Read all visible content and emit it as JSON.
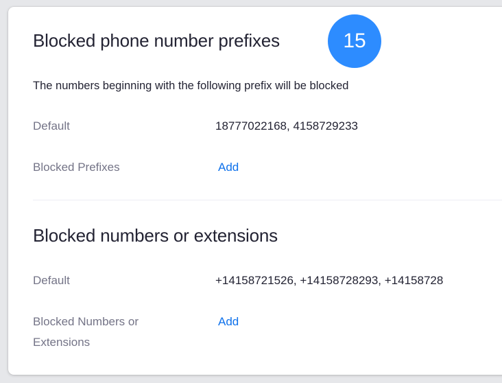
{
  "prefixes_section": {
    "title": "Blocked phone number prefixes",
    "badge": "15",
    "description": "The numbers beginning with the following prefix will be blocked",
    "default_label": "Default",
    "default_value": "18777022168, 4158729233",
    "blocked_label": "Blocked Prefixes",
    "add_label": "Add"
  },
  "numbers_section": {
    "title": "Blocked numbers or extensions",
    "default_label": "Default",
    "default_value": "+14158721526, +14158728293, +14158728",
    "blocked_label": "Blocked Numbers or Extensions",
    "add_label": "Add"
  },
  "colors": {
    "badge": "#2d8cff",
    "link": "#0e71eb",
    "title_text": "#232333",
    "label_text": "#747487"
  }
}
